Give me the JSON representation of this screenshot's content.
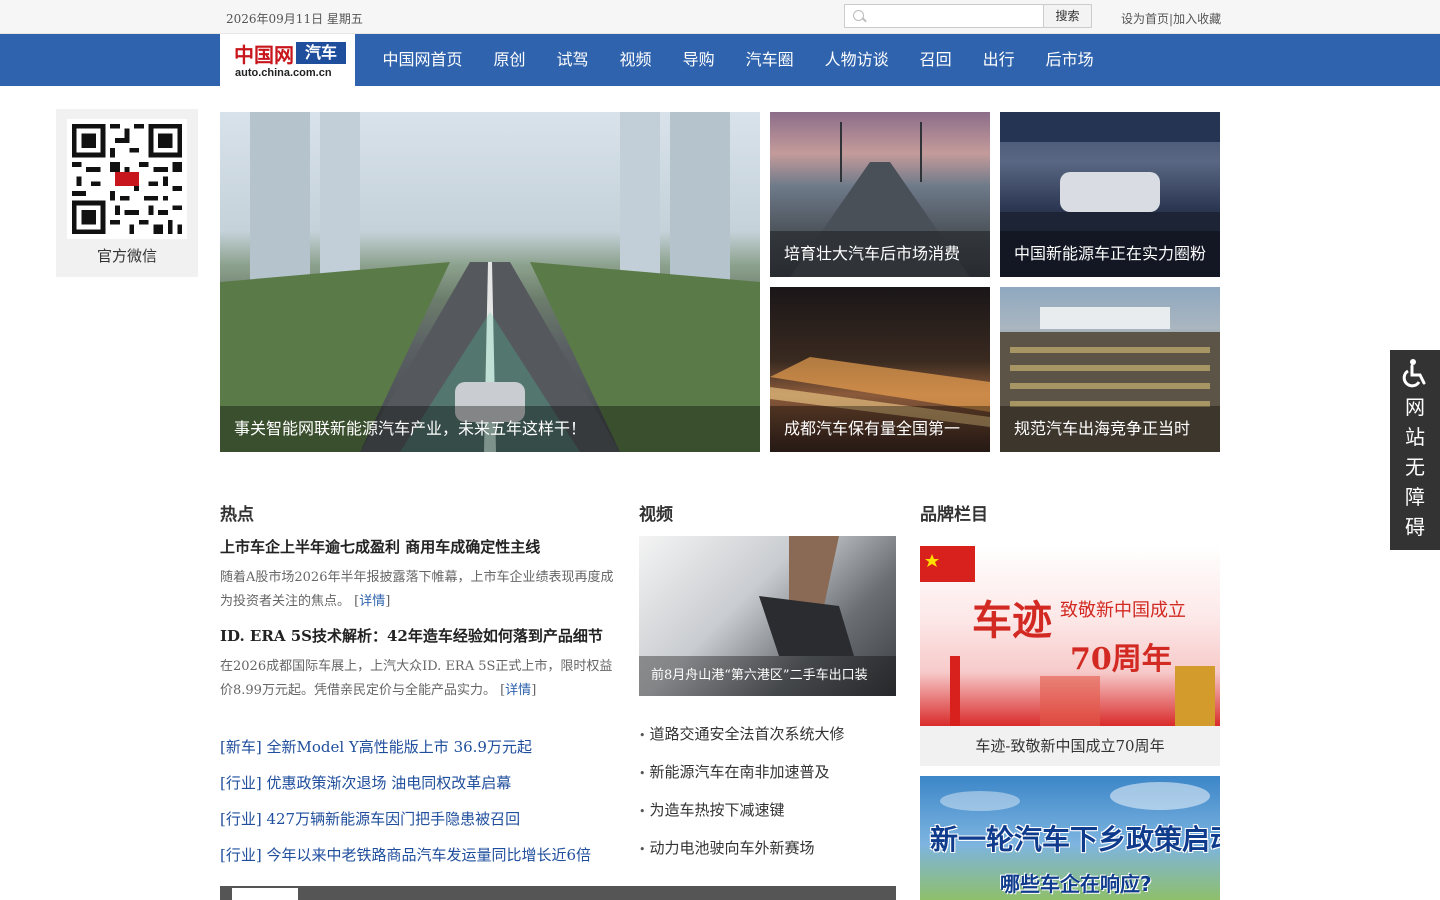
{
  "topbar": {
    "date": "2026年09月11日 星期五",
    "search_placeholder": "",
    "search_button": "搜索",
    "set_home": "设为首页",
    "separator": "|",
    "add_favorite": "加入收藏"
  },
  "logo": {
    "brand": "中国网",
    "section": "汽车",
    "domain": "auto.china.com.cn"
  },
  "nav": {
    "items": [
      "中国网首页",
      "原创",
      "试驾",
      "视频",
      "导购",
      "汽车圈",
      "人物访谈",
      "召回",
      "出行",
      "后市场"
    ]
  },
  "wechat": {
    "label": "官方微信"
  },
  "focus": {
    "main": "事关智能网联新能源汽车产业，未来五年这样干！",
    "r1": "培育壮大汽车后市场消费",
    "r2": "中国新能源车正在实力圈粉",
    "r3": "成都汽车保有量全国第一",
    "r4": "规范汽车出海竞争正当时"
  },
  "sections": {
    "hot": "热点",
    "video": "视频",
    "brand": "品牌栏目"
  },
  "hot": {
    "h1": "上市车企上半年逾七成盈利 商用车成确定性主线",
    "p1": "随着A股市场2026年半年报披露落下帷幕，上市车企业绩表现再度成为投资者关注的焦点。",
    "h2": "ID. ERA 5S技术解析：42年造车经验如何落到产品细节",
    "p2": "在2026成都国际车展上，上汽大众ID. ERA 5S正式上市，限时权益价8.99万元起。凭借亲民定价与全能产品实力。",
    "detail_open": "[",
    "detail_label": "详情",
    "detail_close": "]",
    "list": [
      "[新车] 全新Model Y高性能版上市 36.9万元起",
      "[行业] 优惠政策渐次退场 油电同权改革启幕",
      "[行业] 427万辆新能源车因门把手隐患被召回",
      "[行业] 今年以来中老铁路商品汽车发运量同比增长近6倍"
    ]
  },
  "video": {
    "caption": "前8月舟山港“第六港区”二手车出口装",
    "list": [
      "道路交通安全法首次系统大修",
      "新能源汽车在南非加速普及",
      "为造车热按下减速键",
      "动力电池驶向车外新赛场"
    ]
  },
  "brand": {
    "b1_title": "车迹",
    "b1_line": "致敬新中国成立",
    "b1_years": "70周年",
    "b1_caption": "车迹-致敬新中国成立70周年",
    "b2_line1": "新一轮汽车下乡政策启动",
    "b2_line2": "哪些车企在响应?"
  },
  "accessibility": {
    "chars": [
      "网",
      "站",
      "无",
      "障",
      "碍"
    ]
  }
}
